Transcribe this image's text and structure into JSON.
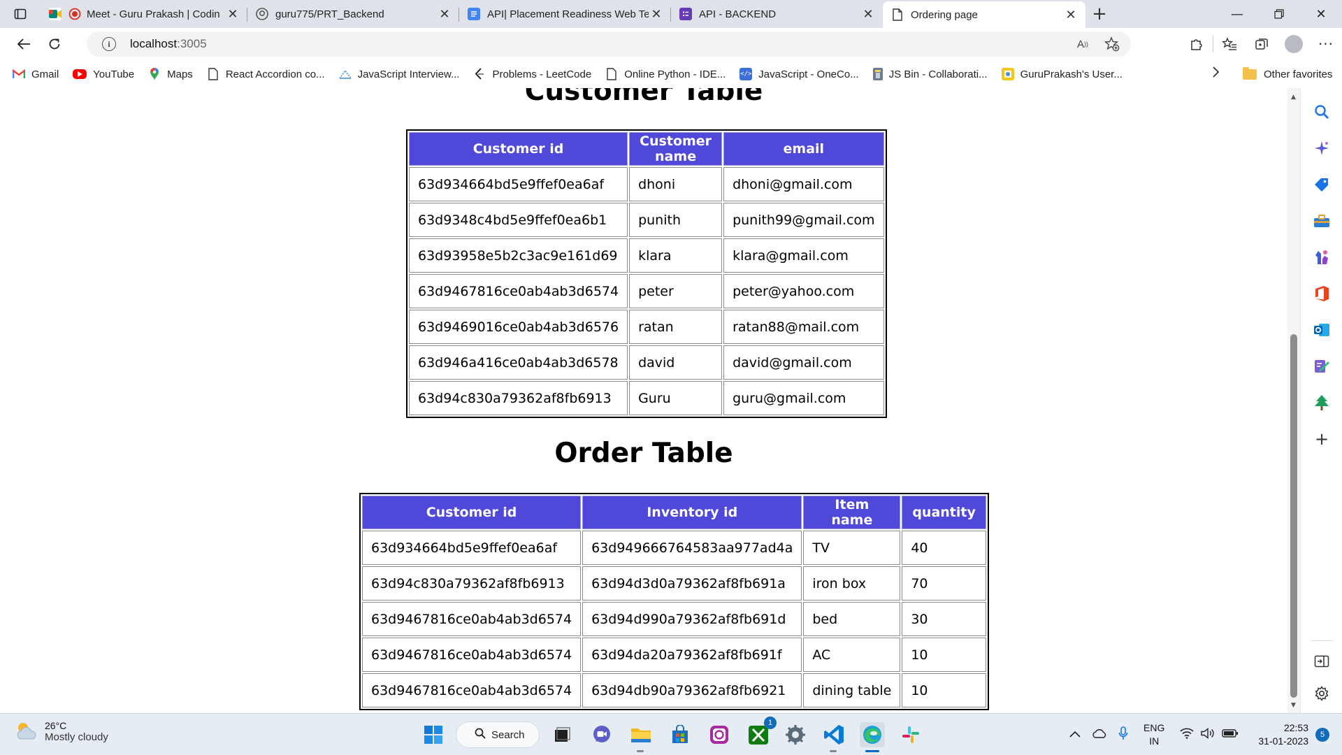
{
  "browser": {
    "tabs": [
      {
        "title": "Meet - Guru Prakash | Codin",
        "favicon": "meet-icon"
      },
      {
        "title": "guru775/PRT_Backend",
        "favicon": "github-icon"
      },
      {
        "title": "API| Placement Readiness Web Te",
        "favicon": "docs-icon"
      },
      {
        "title": "API - BACKEND",
        "favicon": "forms-icon"
      },
      {
        "title": "Ordering page",
        "favicon": "page-icon"
      }
    ],
    "address": {
      "host": "localhost",
      "port": ":3005"
    },
    "favorites": [
      {
        "label": "Gmail",
        "icon": "gmail-icon"
      },
      {
        "label": "YouTube",
        "icon": "youtube-icon"
      },
      {
        "label": "Maps",
        "icon": "maps-icon"
      },
      {
        "label": "React Accordion co...",
        "icon": "page-icon"
      },
      {
        "label": "JavaScript Interview...",
        "icon": "site-icon"
      },
      {
        "label": "Problems - LeetCode",
        "icon": "leetcode-icon"
      },
      {
        "label": "Online Python - IDE...",
        "icon": "page-icon"
      },
      {
        "label": "JavaScript - OneCo...",
        "icon": "code-icon"
      },
      {
        "label": "JS Bin - Collaborati...",
        "icon": "jsbin-icon"
      },
      {
        "label": "GuruPrakash's User...",
        "icon": "site-icon"
      }
    ],
    "other_favorites": "Other favorites"
  },
  "page": {
    "customer_table": {
      "title": "Customer Table",
      "headers": [
        "Customer id",
        "Customer name",
        "email"
      ],
      "rows": [
        [
          "63d934664bd5e9ffef0ea6af",
          "dhoni",
          "dhoni@gmail.com"
        ],
        [
          "63d9348c4bd5e9ffef0ea6b1",
          "punith",
          "punith99@gmail.com"
        ],
        [
          "63d93958e5b2c3ac9e161d69",
          "klara",
          "klara@gmail.com"
        ],
        [
          "63d9467816ce0ab4ab3d6574",
          "peter",
          "peter@yahoo.com"
        ],
        [
          "63d9469016ce0ab4ab3d6576",
          "ratan",
          "ratan88@mail.com"
        ],
        [
          "63d946a416ce0ab4ab3d6578",
          "david",
          "david@gmail.com"
        ],
        [
          "63d94c830a79362af8fb6913",
          "Guru",
          "guru@gmail.com"
        ]
      ]
    },
    "order_table": {
      "title": "Order Table",
      "headers": [
        "Customer id",
        "Inventory id",
        "Item name",
        "quantity"
      ],
      "rows": [
        [
          "63d934664bd5e9ffef0ea6af",
          "63d949666764583aa977ad4a",
          "TV",
          "40"
        ],
        [
          "63d94c830a79362af8fb6913",
          "63d94d3d0a79362af8fb691a",
          "iron box",
          "70"
        ],
        [
          "63d9467816ce0ab4ab3d6574",
          "63d94d990a79362af8fb691d",
          "bed",
          "30"
        ],
        [
          "63d9467816ce0ab4ab3d6574",
          "63d94da20a79362af8fb691f",
          "AC",
          "10"
        ],
        [
          "63d9467816ce0ab4ab3d6574",
          "63d94db90a79362af8fb6921",
          "dining table",
          "10"
        ]
      ]
    }
  },
  "taskbar": {
    "weather": {
      "temp": "26°C",
      "condition": "Mostly cloudy"
    },
    "search_label": "Search",
    "lang": [
      "ENG",
      "IN"
    ],
    "time": "22:53",
    "date": "31-01-2023",
    "notification_count": "5",
    "xbox_badge": "1"
  },
  "colors": {
    "table_header": "#4f48d8",
    "tab_strip": "#dfe3e9",
    "taskbar": "#e6ecf3"
  }
}
